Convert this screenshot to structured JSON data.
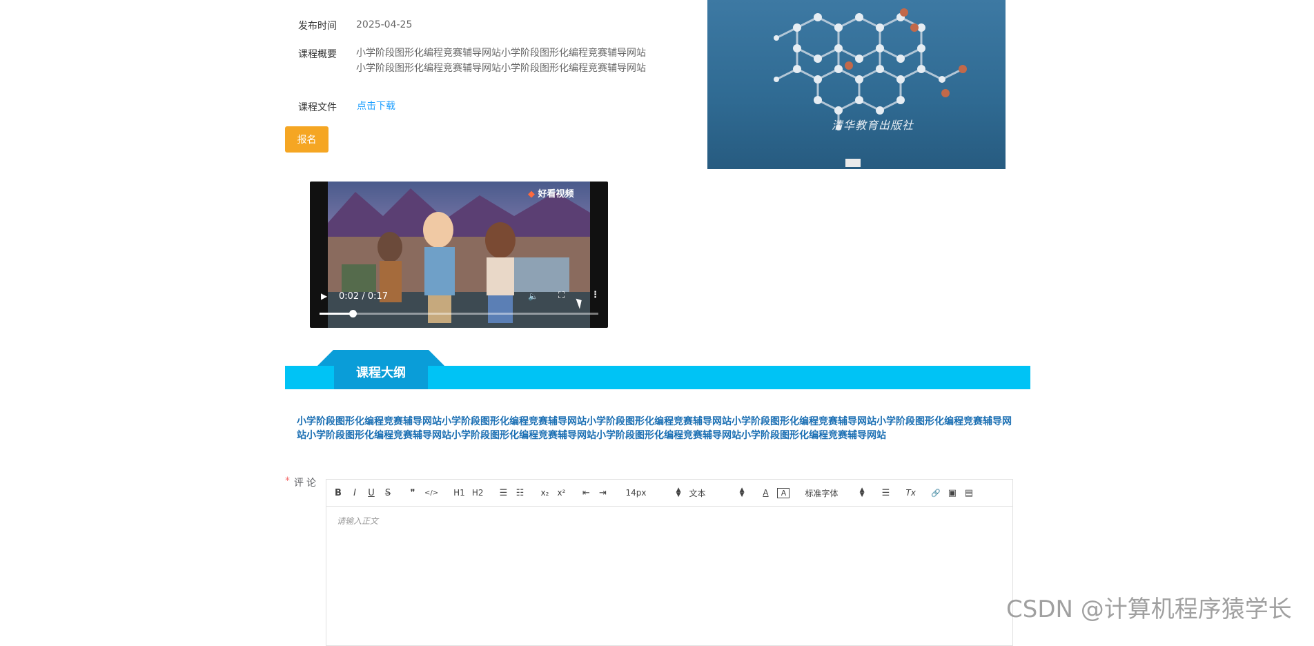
{
  "course_info": {
    "publish_time": {
      "label": "发布时间",
      "value": "2025-04-25"
    },
    "summary": {
      "label": "课程概要",
      "value": "小学阶段图形化编程竞赛辅导网站小学阶段图形化编程竞赛辅导网站小学阶段图形化编程竞赛辅导网站小学阶段图形化编程竞赛辅导网站"
    },
    "file": {
      "label": "课程文件",
      "link_text": "点击下载"
    },
    "signup_label": "报名"
  },
  "book_cover": {
    "logo_text": "清华教育出版社"
  },
  "video": {
    "brand": "好看视频",
    "time": "0:02 / 0:17",
    "progress": 0.12
  },
  "outline": {
    "title": "课程大纲",
    "text": "小学阶段图形化编程竞赛辅导网站小学阶段图形化编程竞赛辅导网站小学阶段图形化编程竞赛辅导网站小学阶段图形化编程竞赛辅导网站小学阶段图形化编程竞赛辅导网站小学阶段图形化编程竞赛辅导网站小学阶段图形化编程竞赛辅导网站小学阶段图形化编程竞赛辅导网站小学阶段图形化编程竞赛辅导网站"
  },
  "comment": {
    "required_mark": "*",
    "label": "评论",
    "placeholder": "请输入正文",
    "toolbar": {
      "bold": "B",
      "italic": "I",
      "underline": "U",
      "strike": "S",
      "quote": "❞",
      "code": "</>",
      "h1": "H1",
      "h2": "H2",
      "ordered_list": "☰",
      "bullet_list": "☷",
      "sub": "x₂",
      "sup": "x²",
      "outdent": "⇤",
      "indent": "⇥",
      "size_value": "14px",
      "header_value": "文本",
      "color": "A",
      "background": "A",
      "font_value": "标准字体",
      "align": "☰",
      "clean": "Tx",
      "link": "🔗",
      "image": "▣",
      "video": "▤"
    }
  },
  "watermark": "CSDN @计算机程序猿学长",
  "colors": {
    "accent": "#00c3f5",
    "tab": "#0a9dd8",
    "button": "#f5a623",
    "link": "#1e9fff"
  }
}
